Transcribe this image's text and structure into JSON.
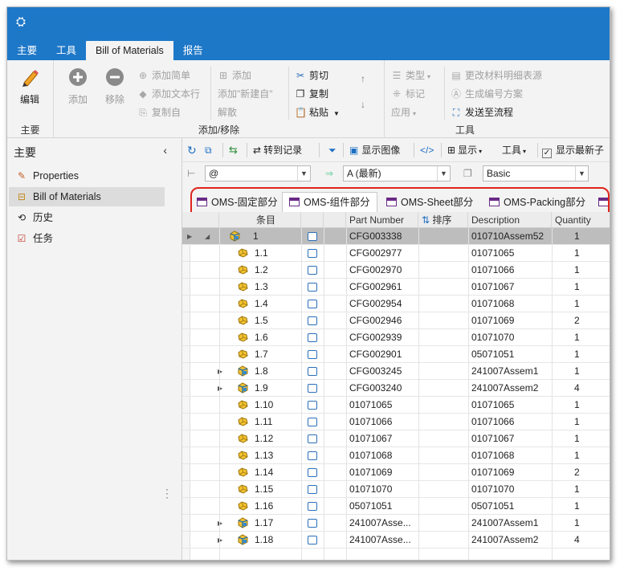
{
  "app": {
    "icon": "app-logo-icon"
  },
  "ribbon_tabs": [
    "主要",
    "工具",
    "Bill of Materials",
    "报告"
  ],
  "ribbon": {
    "group_main": {
      "label": "主要",
      "edit": "编辑"
    },
    "group_add": {
      "label": "添加/移除",
      "add": "添加",
      "remove": "移除",
      "add_list": "添加简单",
      "add_text_line": "添加文本行",
      "copy_from": "复制自",
      "add2": "添加",
      "add_new_from": "添加\"新建自\"",
      "disassemble": "解散",
      "cut": "剪切",
      "copy": "复制",
      "paste": "粘贴"
    },
    "group_tools": {
      "label": "工具",
      "type": "类型",
      "mark": "标记",
      "apply": "应用",
      "change_bom_table": "更改材料明细表源",
      "gen_number_scheme": "生成编号方案",
      "send_to_flow": "发送至流程"
    }
  },
  "nav": {
    "title": "主要",
    "items": [
      {
        "label": "Properties",
        "icon": "pencil-icon"
      },
      {
        "label": "Bill of Materials",
        "icon": "tree-icon"
      },
      {
        "label": "历史",
        "icon": "history-icon"
      },
      {
        "label": "任务",
        "icon": "task-icon"
      }
    ]
  },
  "toolbar": {
    "goto_record": "转到记录",
    "show_image": "显示图像",
    "display": "显示",
    "tools": "工具",
    "show_latest": "显示最新子"
  },
  "filters": {
    "config": "@",
    "version": "A (最新)",
    "view": "Basic"
  },
  "view_tabs": [
    "OMS-固定部分",
    "OMS-组件部分",
    "OMS-Sheet部分",
    "OMS-Packing部分"
  ],
  "grid": {
    "columns": [
      "条目",
      "",
      "Part Number",
      "排序",
      "Description",
      "Quantity"
    ],
    "rows": [
      {
        "item": "1",
        "part": "CFG003338",
        "desc": "010710Assem52",
        "qty": "1",
        "kind": "asm",
        "expand": true,
        "root": true
      },
      {
        "item": "1.1",
        "part": "CFG002977",
        "desc": "01071065",
        "qty": "1",
        "kind": "part",
        "expand": false
      },
      {
        "item": "1.2",
        "part": "CFG002970",
        "desc": "01071066",
        "qty": "1",
        "kind": "part",
        "expand": false
      },
      {
        "item": "1.3",
        "part": "CFG002961",
        "desc": "01071067",
        "qty": "1",
        "kind": "part",
        "expand": false
      },
      {
        "item": "1.4",
        "part": "CFG002954",
        "desc": "01071068",
        "qty": "1",
        "kind": "part",
        "expand": false
      },
      {
        "item": "1.5",
        "part": "CFG002946",
        "desc": "01071069",
        "qty": "2",
        "kind": "part",
        "expand": false
      },
      {
        "item": "1.6",
        "part": "CFG002939",
        "desc": "01071070",
        "qty": "1",
        "kind": "part",
        "expand": false
      },
      {
        "item": "1.7",
        "part": "CFG002901",
        "desc": "05071051",
        "qty": "1",
        "kind": "part",
        "expand": false
      },
      {
        "item": "1.8",
        "part": "CFG003245",
        "desc": "241007Assem1",
        "qty": "1",
        "kind": "asm",
        "expand": true
      },
      {
        "item": "1.9",
        "part": "CFG003240",
        "desc": "241007Assem2",
        "qty": "4",
        "kind": "asm",
        "expand": true
      },
      {
        "item": "1.10",
        "part": "01071065",
        "desc": "01071065",
        "qty": "1",
        "kind": "part",
        "expand": false
      },
      {
        "item": "1.11",
        "part": "01071066",
        "desc": "01071066",
        "qty": "1",
        "kind": "part",
        "expand": false
      },
      {
        "item": "1.12",
        "part": "01071067",
        "desc": "01071067",
        "qty": "1",
        "kind": "part",
        "expand": false
      },
      {
        "item": "1.13",
        "part": "01071068",
        "desc": "01071068",
        "qty": "1",
        "kind": "part",
        "expand": false
      },
      {
        "item": "1.14",
        "part": "01071069",
        "desc": "01071069",
        "qty": "2",
        "kind": "part",
        "expand": false
      },
      {
        "item": "1.15",
        "part": "01071070",
        "desc": "01071070",
        "qty": "1",
        "kind": "part",
        "expand": false
      },
      {
        "item": "1.16",
        "part": "05071051",
        "desc": "05071051",
        "qty": "1",
        "kind": "part",
        "expand": false
      },
      {
        "item": "1.17",
        "part": "241007Asse...",
        "desc": "241007Assem1",
        "qty": "1",
        "kind": "asm",
        "expand": true
      },
      {
        "item": "1.18",
        "part": "241007Asse...",
        "desc": "241007Assem2",
        "qty": "4",
        "kind": "asm",
        "expand": true
      }
    ]
  },
  "colors": {
    "titlebar": "#1e78c8",
    "highlight": "#e0241b",
    "selected_row": "#bdbdbd"
  }
}
